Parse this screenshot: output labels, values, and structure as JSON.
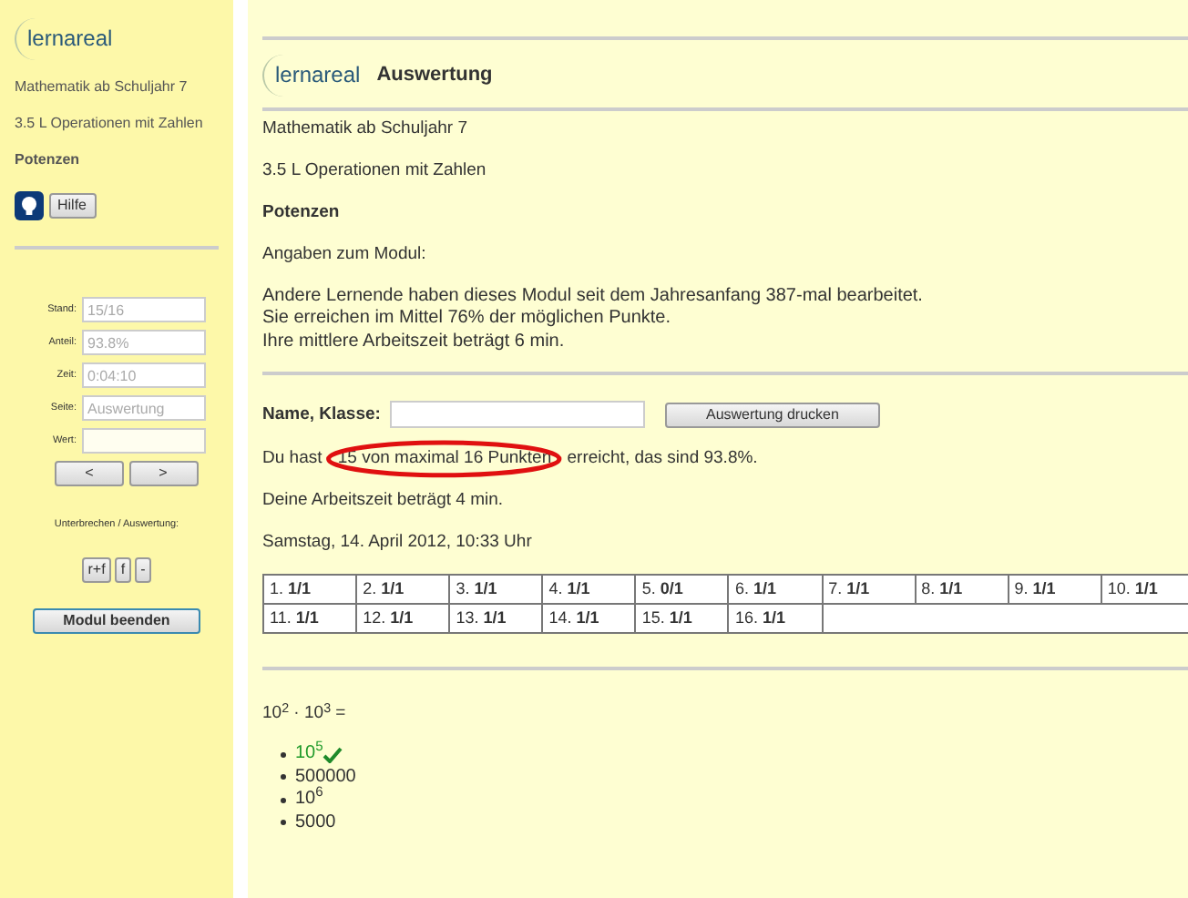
{
  "sidebar": {
    "logo": "lernareal",
    "course": "Mathematik ab Schuljahr 7",
    "unit": "3.5 L Operationen mit Zahlen",
    "topic": "Potenzen",
    "help_button": "Hilfe",
    "fields": [
      {
        "label": "Stand:",
        "value": "15/16",
        "disabled": true
      },
      {
        "label": "Anteil:",
        "value": "93.8%",
        "disabled": true
      },
      {
        "label": "Zeit:",
        "value": "0:04:10",
        "disabled": true
      },
      {
        "label": "Seite:",
        "value": "Auswertung",
        "disabled": true
      },
      {
        "label": "Wert:",
        "disabled": false
      }
    ],
    "nav_buttons": [
      "<",
      ">"
    ],
    "interrupt_label": "Unterbrechen / Auswertung:",
    "small_buttons": [
      "r+f",
      "f",
      "-"
    ],
    "end_button": "Modul beenden"
  },
  "header": {
    "logo": "lernareal",
    "title": "Auswertung"
  },
  "main": {
    "course": "Mathematik ab Schuljahr 7",
    "unit": "3.5 L Operationen mit Zahlen",
    "topic": "Potenzen",
    "info_heading": "Angaben zum Modul:",
    "info_lines": [
      "Andere Lernende haben dieses Modul seit dem Jahresanfang 387-mal bearbeitet.",
      "Sie erreichen im Mittel 76% der möglichen Punkte.",
      "Ihre mittlere Arbeitszeit beträgt 6 min."
    ],
    "name_label": "Name, Klasse:",
    "print_button": "Auswertung drucken",
    "result_parts": [
      {
        "text": "Du hast ",
        "circled": false
      },
      {
        "text": "15 von maximal 16 Punkten",
        "circled": true
      },
      {
        "text": " erreicht, das sind 93.8%.",
        "circled": false
      }
    ],
    "time_text": "Deine Arbeitszeit beträgt 4 min.",
    "date_text": "Samstag, 14. April 2012, 10:33 Uhr",
    "scores": [
      "1. **1/1**",
      "2. **1/1**",
      "3. **1/1**",
      "4. **1/1**",
      "5. **0/1**",
      "6. **1/1**",
      "7. **1/1**",
      "8. **1/1**",
      "9. **1/1**",
      "10. **1/1**",
      "11. **1/1**",
      "12. **1/1**",
      "13. **1/1**",
      "14. **1/1**",
      "15. **1/1**",
      "16. **1/1**"
    ],
    "question": "10$^{2}$ · 10$^{3}$ =",
    "options": [
      {
        "text": "10$^{5}$",
        "correct": true
      },
      {
        "text": "500000",
        "correct": false
      },
      {
        "text": "10$^{6}$",
        "correct": false
      },
      {
        "text": "5000",
        "correct": false
      }
    ]
  }
}
